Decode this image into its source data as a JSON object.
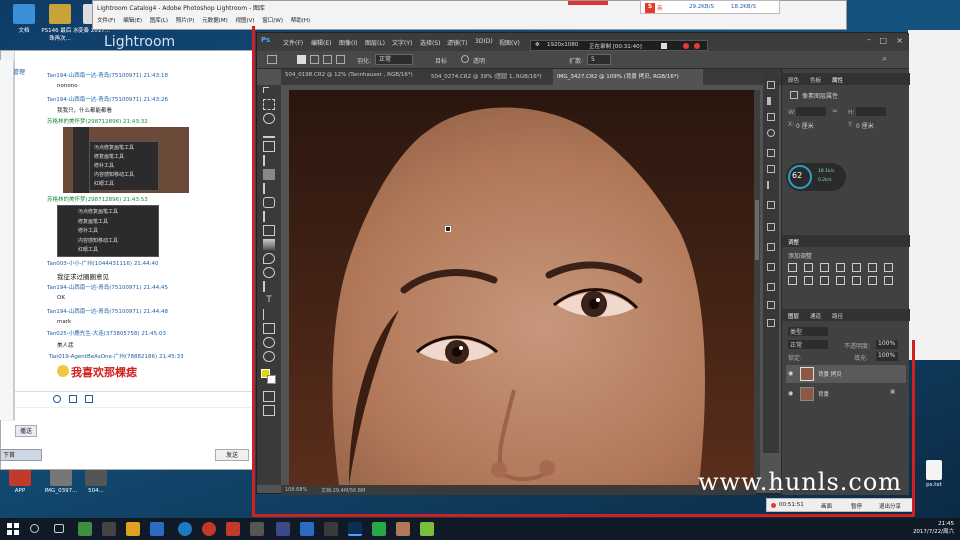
{
  "desktop": {
    "icons": [
      {
        "label": "文档"
      },
      {
        "label": "PS146 最后 水珠再次..."
      },
      {
        "label": "变奏 2017..."
      },
      {
        "label": "APP"
      },
      {
        "label": "IMG_0397..."
      },
      {
        "label": "504..."
      },
      {
        "label": "ps.txt"
      }
    ],
    "lightroom_label": "Lightroom"
  },
  "lightroom": {
    "title": "Lightroom Catalog4 - Adobe Photoshop Lightroom - 图库",
    "menu": "文件(F)  编辑(E)  图库(L)  照片(P)  元数据(M)  视图(V)  窗口(W)  帮助(H)"
  },
  "sogou": {
    "speed_up": "29.2KB/S",
    "speed_down": "18.2KB/S",
    "brand": "英"
  },
  "chat": {
    "side_label": "管理",
    "messages": [
      {
        "name": "Tan194-山西南一达-青岛(75100971)",
        "time": "21:43:18",
        "text": "nonono"
      },
      {
        "name": "Tan194-山西南一达-青岛(75100971)",
        "time": "21:43:26",
        "text": "我我只，什么都能都看"
      },
      {
        "name": "苏格林的美怀梦(298712896)",
        "time": "21:43:32",
        "text": ""
      },
      {
        "name": "苏格林的美怀梦(298712896)",
        "time": "21:43:53",
        "text": ""
      },
      {
        "name": "Tan003-小小-广州(1044431116)",
        "time": "21:44:40",
        "text": "我征求过圈圈意见"
      },
      {
        "name": "Tan194-山西南一达-青岛(75100971)",
        "time": "21:44:45",
        "text": "OK"
      },
      {
        "name": "Tan194-山西南一达-青岛(75100971)",
        "time": "21:44:48",
        "text": "mark"
      },
      {
        "name": "Tan025-小鹿先生-大连(373805758)",
        "time": "21:45:03",
        "text": "美人痣"
      },
      {
        "name": "Tan019-AgentBeAsOne-广州(78882186)",
        "time": "21:45:33",
        "text": "我喜欢那棵痣"
      }
    ],
    "menu_items": [
      "污点修复画笔工具",
      "修复画笔工具",
      "修补工具",
      "内容感知移动工具",
      "红眼工具"
    ],
    "send_label": "发送",
    "close_label": "关闭",
    "left_labels": [
      "下首",
      "播送"
    ]
  },
  "photoshop": {
    "logo": "Ps",
    "menu": [
      "文件(F)",
      "编辑(E)",
      "图像(I)",
      "图层(L)",
      "文字(Y)",
      "选择(S)",
      "滤镜(T)",
      "3D(D)",
      "视图(V)"
    ],
    "options": {
      "feather": "羽化:",
      "feather_val": "正常",
      "mode": "目标",
      "transparent": "透明",
      "diffusion": "扩散:",
      "diffusion_val": "5"
    },
    "tabs": [
      "504_0198.CR2 @ 12% (Tannhauser , RGB/16*)",
      "504_0274.CR2 @ 39% (图层 1, RGB/16*)",
      "IMG_3427.CR2 @ 109% (背景 拷贝, RGB/16*)"
    ],
    "status": {
      "zoom": "108.68%",
      "doc": "文档:29.4M/56.8M"
    },
    "panels": {
      "top_tabs": [
        "颜色",
        "色板",
        "属性"
      ],
      "properties_title": "像素图层属性",
      "w_label": "W:",
      "h_label": "H:",
      "x_label": "X:",
      "y_label": "Y:",
      "w_val": "0 厘米",
      "h_val": "0 厘米",
      "cpu": "62",
      "net_up": "18.1k/s",
      "net_down": "0.2k/s",
      "adjust_tab": "调整",
      "adjust_label": "添加调整",
      "layer_tabs": [
        "图层",
        "通道",
        "路径"
      ],
      "kind_label": "类型",
      "blend": "正常",
      "opacity_label": "不透明度:",
      "opacity": "100%",
      "lock_label": "锁定:",
      "fill_label": "填充:",
      "fill": "100%",
      "layers": [
        {
          "name": "背景 拷贝",
          "active": true
        },
        {
          "name": "背景",
          "active": false
        }
      ]
    }
  },
  "recorder": {
    "resolution": "1920x1080",
    "status": "正在录制 [00:31:40]",
    "time": "00:51:51",
    "buttons": [
      "画面",
      "暂停",
      "退出分享"
    ]
  },
  "watermark": "www.hunls.com",
  "taskbar": {
    "time": "21:45",
    "date": "2017/7/22/周六"
  }
}
